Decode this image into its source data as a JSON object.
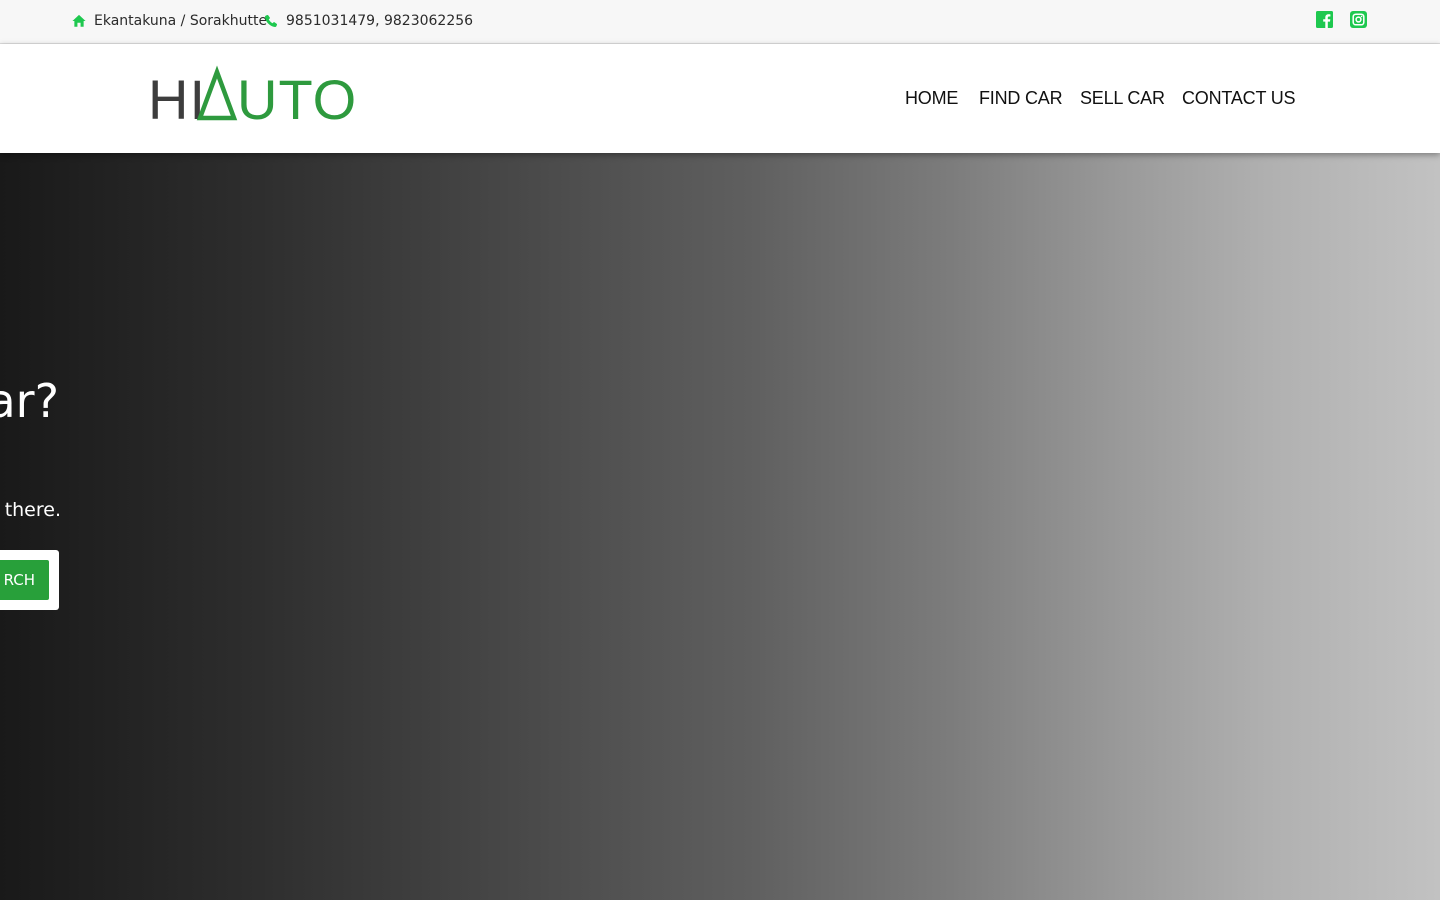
{
  "topbar": {
    "address": "Ekantakuna / Sorakhutte",
    "address_icon": "home-icon",
    "phone": "9851031479, 9823062256",
    "phone_icon": "phone-icon",
    "social": [
      "facebook-icon",
      "instagram-icon"
    ],
    "accent_color": "#1ec84f"
  },
  "logo": {
    "text_dark": "HI",
    "text_green": "UTO",
    "brand_mark": "HIΔUTO",
    "colors": {
      "dark": "#3d3d3d",
      "green": "#2e9a3e"
    }
  },
  "nav": {
    "items": [
      {
        "label": "HOME"
      },
      {
        "label": "FIND CAR"
      },
      {
        "label": "SELL CAR"
      },
      {
        "label": "CONTACT US"
      }
    ]
  },
  "hero": {
    "heading_visible": "ar?",
    "subtitle_visible": " there.",
    "search_button_label": "RCH",
    "button_color": "#28a03a"
  }
}
